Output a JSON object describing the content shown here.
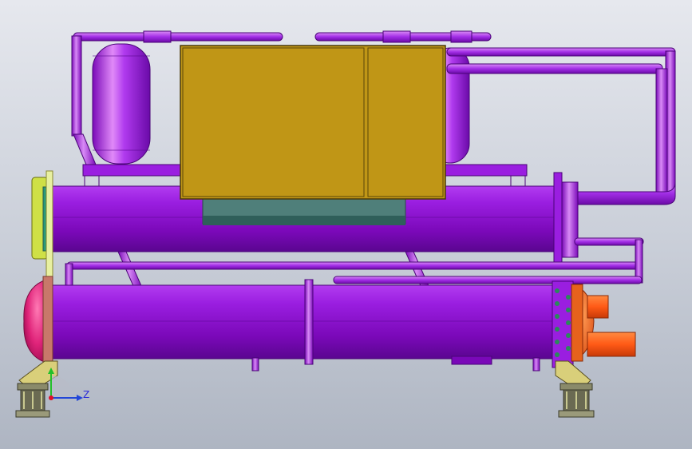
{
  "viewport": {
    "background_top": "#e6e8ee",
    "background_bottom": "#aeb5c2"
  },
  "colors": {
    "shell_purple": "#8a10c8",
    "pipe_purple": "#a82ee6",
    "control_box_gold": "#c09616",
    "control_base_teal": "#4f7f7a",
    "end_cap_pink": "#e0247a",
    "outlet_orange": "#ff5a16",
    "cover_yellow": "#cfe046",
    "foot_tan": "#d9cf7a"
  },
  "triad": {
    "z_label": "Z",
    "x_axis_color": "#2246d8",
    "y_axis_color": "#22c02a",
    "origin_color": "#e0102a"
  }
}
